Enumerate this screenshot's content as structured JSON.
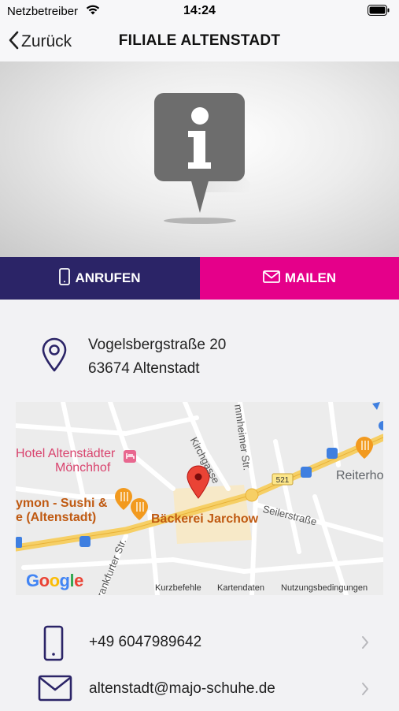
{
  "status_bar": {
    "carrier": "Netzbetreiber",
    "time": "14:24"
  },
  "nav": {
    "back_label": "Zurück",
    "title": "FILIALE ALTENSTADT"
  },
  "actions": {
    "call_label": "ANRUFEN",
    "mail_label": "MAILEN",
    "call_color": "#2b2467",
    "mail_color": "#e5008a"
  },
  "address": {
    "street": "Vogelsbergstraße 20",
    "city": "63674 Altenstadt"
  },
  "map": {
    "labels": {
      "hotel_line1": "Hotel Altenstädter",
      "hotel_line2": "Mönchhof",
      "sushi_line1": "ymon - Sushi &",
      "sushi_line2": "e (Altenstadt)",
      "bakery": "Bäckerei Jarchow",
      "kirchgasse": "Kirchgasse",
      "hammersheimer": "mmheimer Str.",
      "seilerstrasse": "Seilerstraße",
      "frankfurter": "rankfurter Str.",
      "reiterhof": "Reiterho",
      "route": "521"
    },
    "footer": {
      "shortcuts": "Kurzbefehle",
      "map_data": "Kartendaten",
      "terms": "Nutzungsbedingungen"
    },
    "logo_letters": [
      "G",
      "o",
      "o",
      "g",
      "l",
      "e"
    ]
  },
  "contact": {
    "phone": "+49 6047989642",
    "email": "altenstadt@majo-schuhe.de"
  },
  "icons": {
    "back": "chevron-left-icon",
    "hero": "info-pin-icon",
    "call": "phone-icon",
    "mail": "envelope-icon",
    "location": "location-pin-icon",
    "chevron": "chevron-right-icon"
  }
}
